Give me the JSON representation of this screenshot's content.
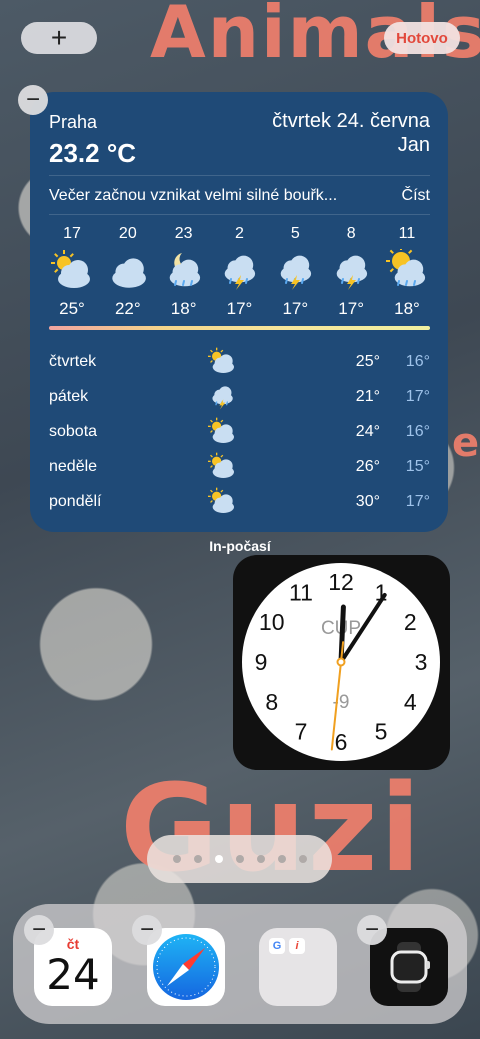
{
  "wallpaper": {
    "top_text": "Animals",
    "side_text": "e",
    "bottom_text": "Guzi"
  },
  "top_bar": {
    "add_label": "+",
    "done_label": "Hotovo"
  },
  "remove_symbol": "−",
  "weather": {
    "city": "Praha",
    "temperature": "23.2 °C",
    "date": "čtvrtek 24. června",
    "name_day": "Jan",
    "alert": "Večer začnou vznikat velmi silné bouřk...",
    "read_label": "Číst",
    "hourly": [
      {
        "hour": "17",
        "icon": "sun-cloud-icon",
        "temp": "25°"
      },
      {
        "hour": "20",
        "icon": "cloud-icon",
        "temp": "22°"
      },
      {
        "hour": "23",
        "icon": "moon-cloud-rain-icon",
        "temp": "18°"
      },
      {
        "hour": "2",
        "icon": "thunderstorm-icon",
        "temp": "17°"
      },
      {
        "hour": "5",
        "icon": "thunderstorm-icon",
        "temp": "17°"
      },
      {
        "hour": "8",
        "icon": "thunderstorm-icon",
        "temp": "17°"
      },
      {
        "hour": "11",
        "icon": "sun-cloud-rain-icon",
        "temp": "18°"
      }
    ],
    "daily": [
      {
        "day": "čtvrtek",
        "icon": "sun-cloud-icon",
        "high": "25°",
        "low": "16°"
      },
      {
        "day": "pátek",
        "icon": "thunderstorm-icon",
        "high": "21°",
        "low": "17°"
      },
      {
        "day": "sobota",
        "icon": "sun-cloud-icon",
        "high": "24°",
        "low": "16°"
      },
      {
        "day": "neděle",
        "icon": "sun-cloud-icon",
        "high": "26°",
        "low": "15°"
      },
      {
        "day": "pondělí",
        "icon": "sun-cloud-icon",
        "high": "30°",
        "low": "17°"
      }
    ],
    "caption": "In-počasí"
  },
  "clock": {
    "city_code": "CUP",
    "offset": "-9",
    "numbers": [
      "12",
      "1",
      "2",
      "3",
      "4",
      "5",
      "6",
      "7",
      "8",
      "9",
      "10",
      "11"
    ],
    "time_hour": 12,
    "time_minute": 5,
    "time_second": 31
  },
  "page_indicator": {
    "count": 7,
    "active_index": 2
  },
  "dock": {
    "calendar": {
      "weekday": "čt",
      "date": "24"
    },
    "apps": [
      "calendar-app",
      "safari-app",
      "google-folder",
      "watch-app"
    ]
  },
  "colors": {
    "weather_bg": "#1f4a77",
    "done_text": "#e2483b",
    "second_hand": "#f0a020"
  }
}
